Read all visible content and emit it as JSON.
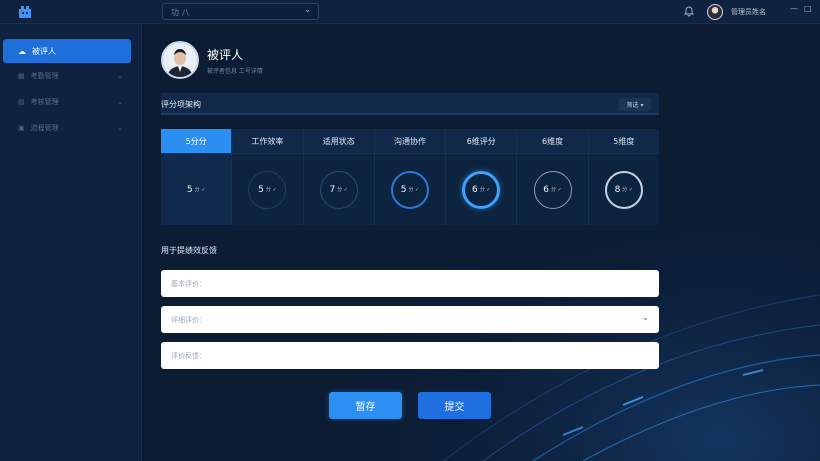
{
  "topbar": {
    "select_value": "功 八",
    "user_name": "管理员姓名",
    "win_controls": [
      "—",
      "□"
    ]
  },
  "sidebar": {
    "active": {
      "label": "被评人",
      "icon": "cloud-icon"
    },
    "items": [
      {
        "label": "考勤管理",
        "icon": "grid-icon"
      },
      {
        "label": "考核管理",
        "icon": "chart-icon"
      },
      {
        "label": "流程管理",
        "icon": "doc-icon"
      }
    ]
  },
  "profile": {
    "title": "被评人",
    "subtitle": "被评者信息  工号详情"
  },
  "section": {
    "title": "评分项架构",
    "button": "筛选 ▾"
  },
  "grid": {
    "columns": [
      {
        "header": "5分分",
        "value": "5",
        "unit": "分 ✓",
        "style": "none",
        "active": true
      },
      {
        "header": "工作效率",
        "value": "5",
        "unit": "分 ✓",
        "style": "faint",
        "active": false
      },
      {
        "header": "适用状态",
        "value": "7",
        "unit": "分 ✓",
        "style": "dim",
        "active": false
      },
      {
        "header": "沟通协作",
        "value": "5",
        "unit": "分 ✓",
        "style": "blue",
        "active": false
      },
      {
        "header": "6维评分",
        "value": "6",
        "unit": "分 ✓",
        "style": "bright",
        "active": false
      },
      {
        "header": "6维度",
        "value": "6",
        "unit": "分 ✓",
        "style": "gray",
        "active": false
      },
      {
        "header": "5维度",
        "value": "8",
        "unit": "分 ✓",
        "style": "white",
        "active": false
      }
    ]
  },
  "feedback": {
    "title": "用于提绩效反馈",
    "fields": [
      {
        "placeholder": "基本评价：",
        "has_chevron": false
      },
      {
        "placeholder": "详细评价：",
        "has_chevron": true
      },
      {
        "placeholder": "评价反馈：",
        "has_chevron": false
      }
    ]
  },
  "actions": {
    "save": "暂存",
    "submit": "提交"
  },
  "colors": {
    "accent": "#2e8ff2",
    "background": "#0b1c33",
    "active_nav": "#1e6fd9"
  }
}
